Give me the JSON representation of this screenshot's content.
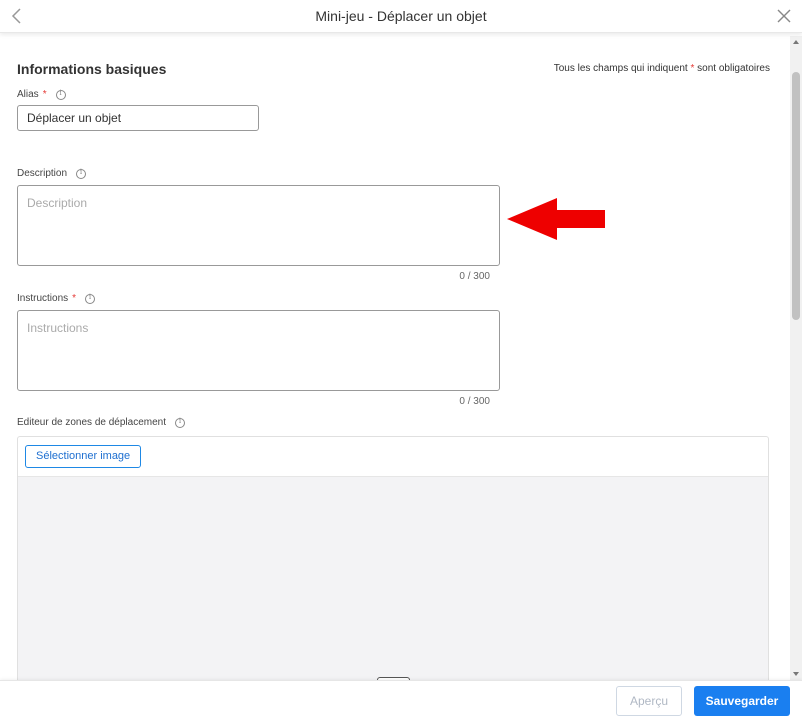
{
  "header": {
    "title": "Mini-jeu - Déplacer un objet"
  },
  "basic_info": {
    "title": "Informations basiques",
    "required_note_prefix": "Tous les champs qui indiquent",
    "required_star": "*",
    "required_note_suffix": "sont obligatoires"
  },
  "alias": {
    "label": "Alias",
    "value": "Déplacer un objet"
  },
  "description": {
    "label": "Description",
    "placeholder": "Description",
    "counter": "0 / 300"
  },
  "instructions": {
    "label": "Instructions",
    "placeholder": "Instructions",
    "counter": "0 / 300"
  },
  "editor": {
    "label": "Editeur de zones de déplacement",
    "select_image_label": "Sélectionner image"
  },
  "footer": {
    "preview_label": "Aperçu",
    "save_label": "Sauvegarder"
  },
  "colors": {
    "accent": "#1a7ff0",
    "required": "#e53935",
    "annotation_arrow": "#ee0000"
  }
}
